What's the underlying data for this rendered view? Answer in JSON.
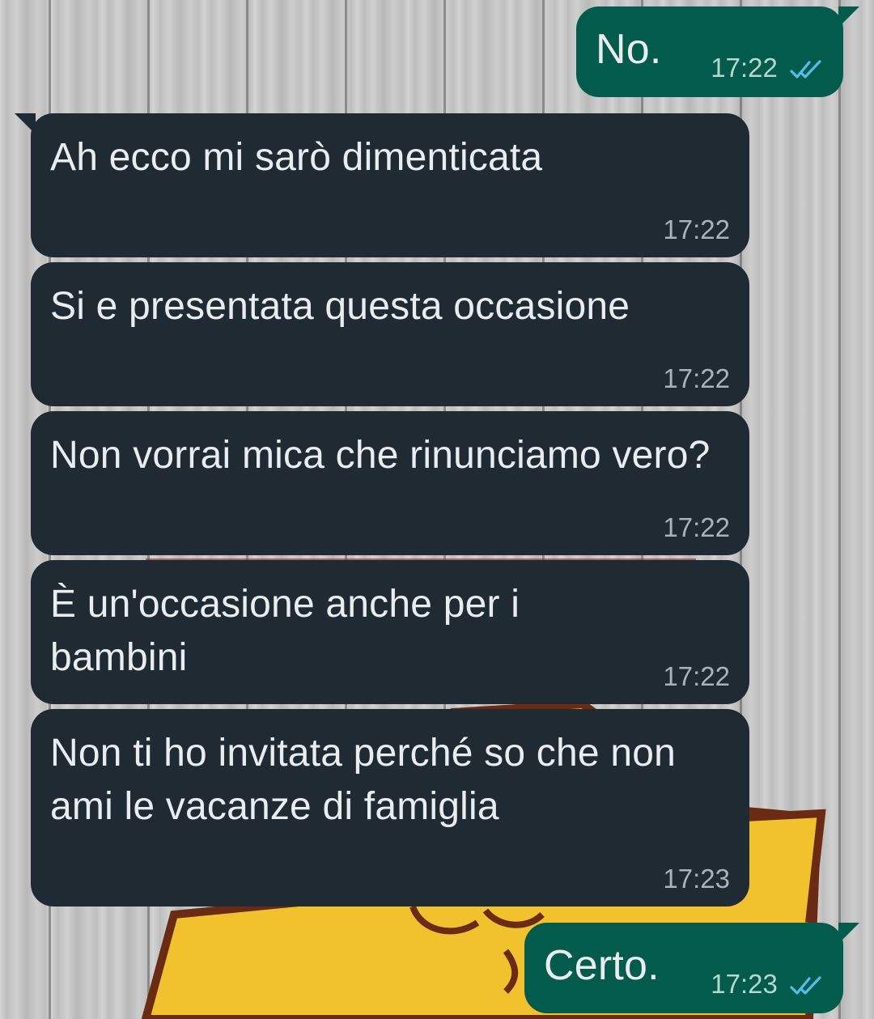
{
  "chat": {
    "messages": [
      {
        "id": "m1",
        "direction": "outgoing",
        "text": "No.",
        "time": "17:22",
        "status": "read"
      },
      {
        "id": "m2",
        "direction": "incoming",
        "text": "Ah ecco mi sarò dimenticata",
        "time": "17:22"
      },
      {
        "id": "m3",
        "direction": "incoming",
        "text": "Si e presentata questa occasione",
        "time": "17:22"
      },
      {
        "id": "m4",
        "direction": "incoming",
        "text": "Non vorrai mica che rinunciamo vero?",
        "time": "17:22"
      },
      {
        "id": "m5",
        "direction": "incoming",
        "text": "È un'occasione anche per i bambini",
        "time": "17:22"
      },
      {
        "id": "m6",
        "direction": "incoming",
        "text": "Non ti ho invitata perché so che non ami le vacanze di famiglia",
        "time": "17:23"
      },
      {
        "id": "m7",
        "direction": "outgoing",
        "text": "Certo.",
        "time": "17:23",
        "status": "read"
      }
    ]
  },
  "theme": {
    "incoming_bubble": "#1f2a33",
    "outgoing_bubble": "#035c4b",
    "text_color": "#e9edef",
    "read_ticks_color": "#53bdeb",
    "wallpaper": "grey-wood-planks-with-yellow-star"
  },
  "icons": {
    "read_receipt": "double-check-icon"
  }
}
